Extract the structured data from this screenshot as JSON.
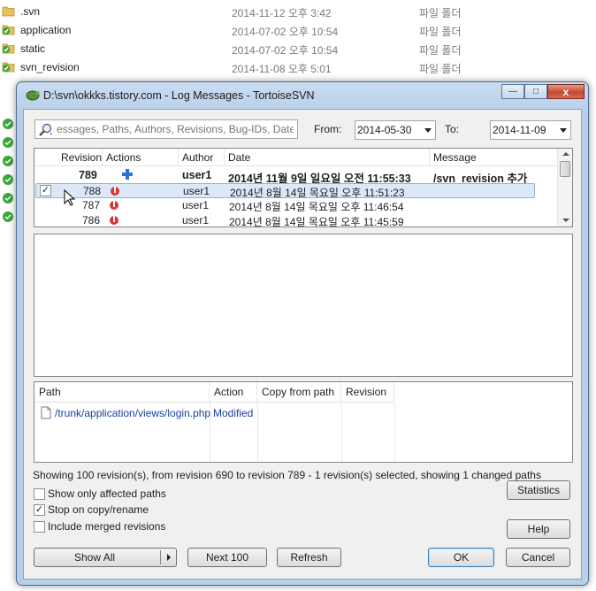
{
  "explorer": {
    "rows": [
      {
        "name": ".svn",
        "date": "2014-11-12 오후 3:42",
        "type": "파일 폴더"
      },
      {
        "name": "application",
        "date": "2014-07-02 오후 10:54",
        "type": "파일 폴더"
      },
      {
        "name": "static",
        "date": "2014-07-02 오후 10:54",
        "type": "파일 폴더"
      },
      {
        "name": "svn_revision",
        "date": "2014-11-08 오후 5:01",
        "type": "파일 폴더"
      }
    ]
  },
  "window": {
    "title": "D:\\svn\\okkks.tistory.com - Log Messages - TortoiseSVN",
    "minimize": "—",
    "maximize": "□",
    "close": "x"
  },
  "filter": {
    "search_placeholder": "essages, Paths, Authors, Revisions, Bug-IDs, Date,",
    "from_label": "From:",
    "from_value": "2014-05-30",
    "to_label": "To:",
    "to_value": "2014-11-09"
  },
  "revisions": {
    "headers": {
      "revision": "Revision",
      "actions": "Actions",
      "author": "Author",
      "date": "Date",
      "message": "Message"
    },
    "rows": [
      {
        "revision": "789",
        "author": "user1",
        "date": "2014년 11월 9일 일요일 오전 11:55:33",
        "message": "/svn_revision 추가"
      },
      {
        "revision": "788",
        "author": "user1",
        "date": "2014년 8월 14일 목요일 오후 11:51:23",
        "message": "",
        "checked": true
      },
      {
        "revision": "787",
        "author": "user1",
        "date": "2014년 8월 14일 목요일 오후 11:46:54",
        "message": ""
      },
      {
        "revision": "786",
        "author": "user1",
        "date": "2014년 8월 14일 목요일 오후 11:45:59",
        "message": ""
      }
    ]
  },
  "paths": {
    "headers": {
      "path": "Path",
      "action": "Action",
      "copy_from": "Copy from path",
      "revision": "Revision"
    },
    "rows": [
      {
        "path": "/trunk/application/views/login.php",
        "action": "Modified",
        "copy_from": "",
        "revision": ""
      }
    ]
  },
  "status_text": "Showing 100 revision(s), from revision 690 to revision 789 - 1 revision(s) selected, showing 1 changed paths",
  "options": {
    "show_affected": "Show only affected paths",
    "stop_on_copy": "Stop on copy/rename",
    "include_merged": "Include merged revisions"
  },
  "buttons": {
    "statistics": "Statistics",
    "help": "Help",
    "show_all": "Show All",
    "next_100": "Next 100",
    "refresh": "Refresh",
    "ok": "OK",
    "cancel": "Cancel"
  },
  "colors": {
    "selection": "#dbe8f8",
    "link_blue": "#1a3fa3",
    "title_bar": "#b9cfe9"
  }
}
